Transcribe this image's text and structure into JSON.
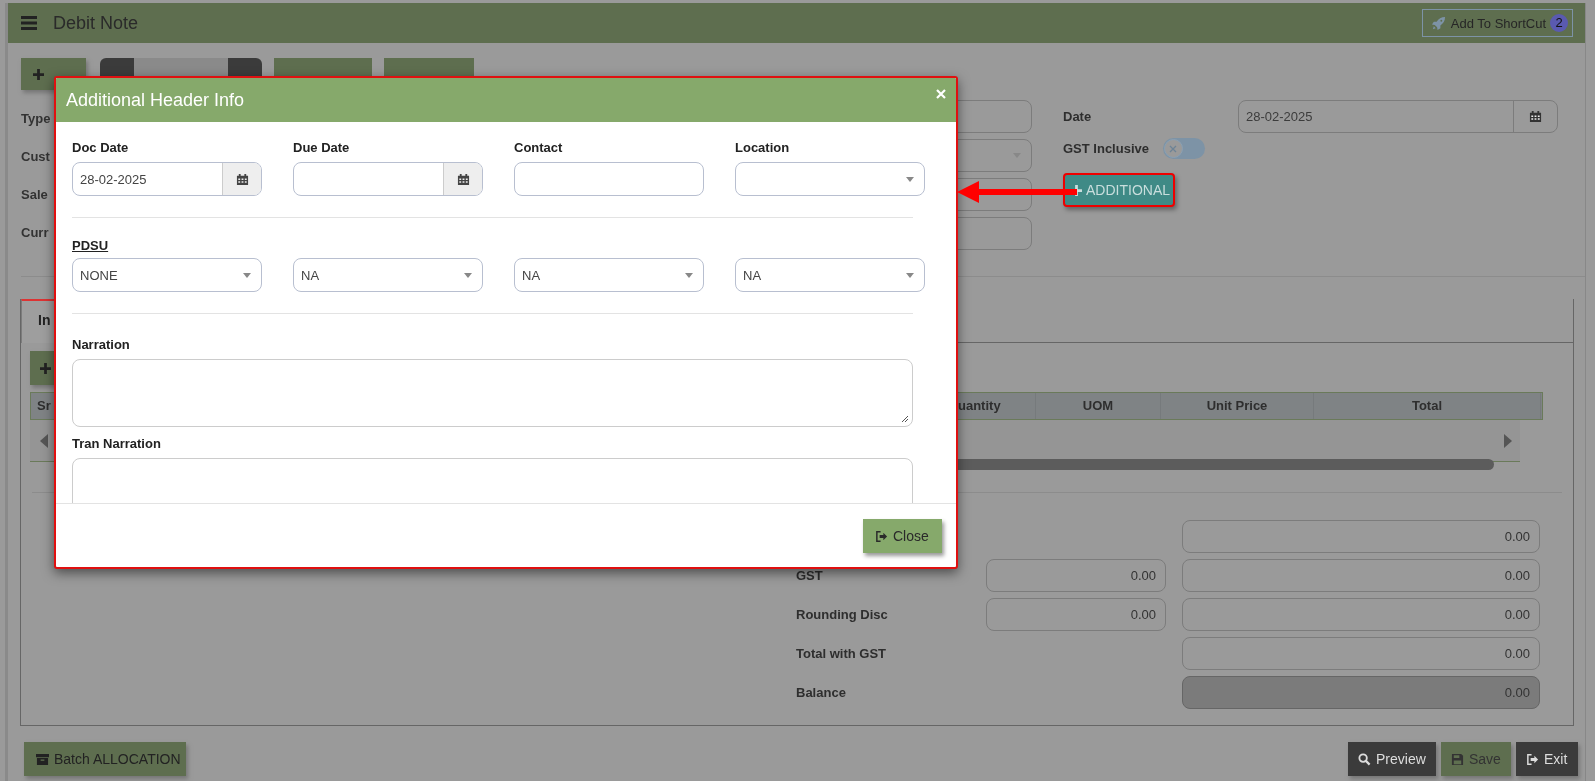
{
  "header": {
    "title": "Debit Note",
    "shortcut_button": "Add To ShortCut",
    "shortcut_badge": "2"
  },
  "form": {
    "left_labels": [
      "Type",
      "Cust",
      "Sale",
      "Curr"
    ],
    "date_label": "Date",
    "date_value": "28-02-2025",
    "gst_inclusive": {
      "label": "GST Inclusive",
      "on": false
    },
    "additional_button": "ADDITIONAL"
  },
  "tabs": [
    {
      "label": "In",
      "selected": true
    }
  ],
  "items_table": {
    "columns": [
      "Sr",
      "uantity",
      "UOM",
      "Unit Price",
      "Total"
    ]
  },
  "totals": [
    {
      "kind": "single",
      "values": [
        "0.00"
      ],
      "disabled": false
    },
    {
      "kind": "double",
      "label": "GST",
      "values": [
        "0.00",
        "0.00"
      ],
      "disabled": false
    },
    {
      "kind": "double",
      "label": "Rounding Disc",
      "values": [
        "0.00",
        "0.00"
      ],
      "disabled": false
    },
    {
      "kind": "single",
      "label": "Total with GST",
      "values": [
        "0.00"
      ],
      "disabled": false
    },
    {
      "kind": "single",
      "label": "Balance",
      "values": [
        "0.00"
      ],
      "disabled": true
    }
  ],
  "footer_buttons": [
    {
      "kind": "batch",
      "label": "Batch ALLOCATION"
    },
    {
      "kind": "preview",
      "label": "Preview"
    },
    {
      "kind": "save",
      "label": "Save"
    },
    {
      "kind": "exit",
      "label": "Exit"
    }
  ],
  "dialog": {
    "title": "Additional Header Info",
    "fields": [
      {
        "kind": "date",
        "label": "Doc Date",
        "value": "28-02-2025"
      },
      {
        "kind": "date",
        "label": "Due Date"
      },
      {
        "kind": "text",
        "label": "Contact"
      },
      {
        "kind": "select",
        "label": "Location"
      }
    ],
    "pdsu": {
      "label": "PDSU",
      "selects": [
        "NONE",
        "NA",
        "NA",
        "NA"
      ]
    },
    "narration": {
      "label": "Narration"
    },
    "tran_narration": {
      "label": "Tran Narration"
    },
    "close_button": "Close"
  }
}
